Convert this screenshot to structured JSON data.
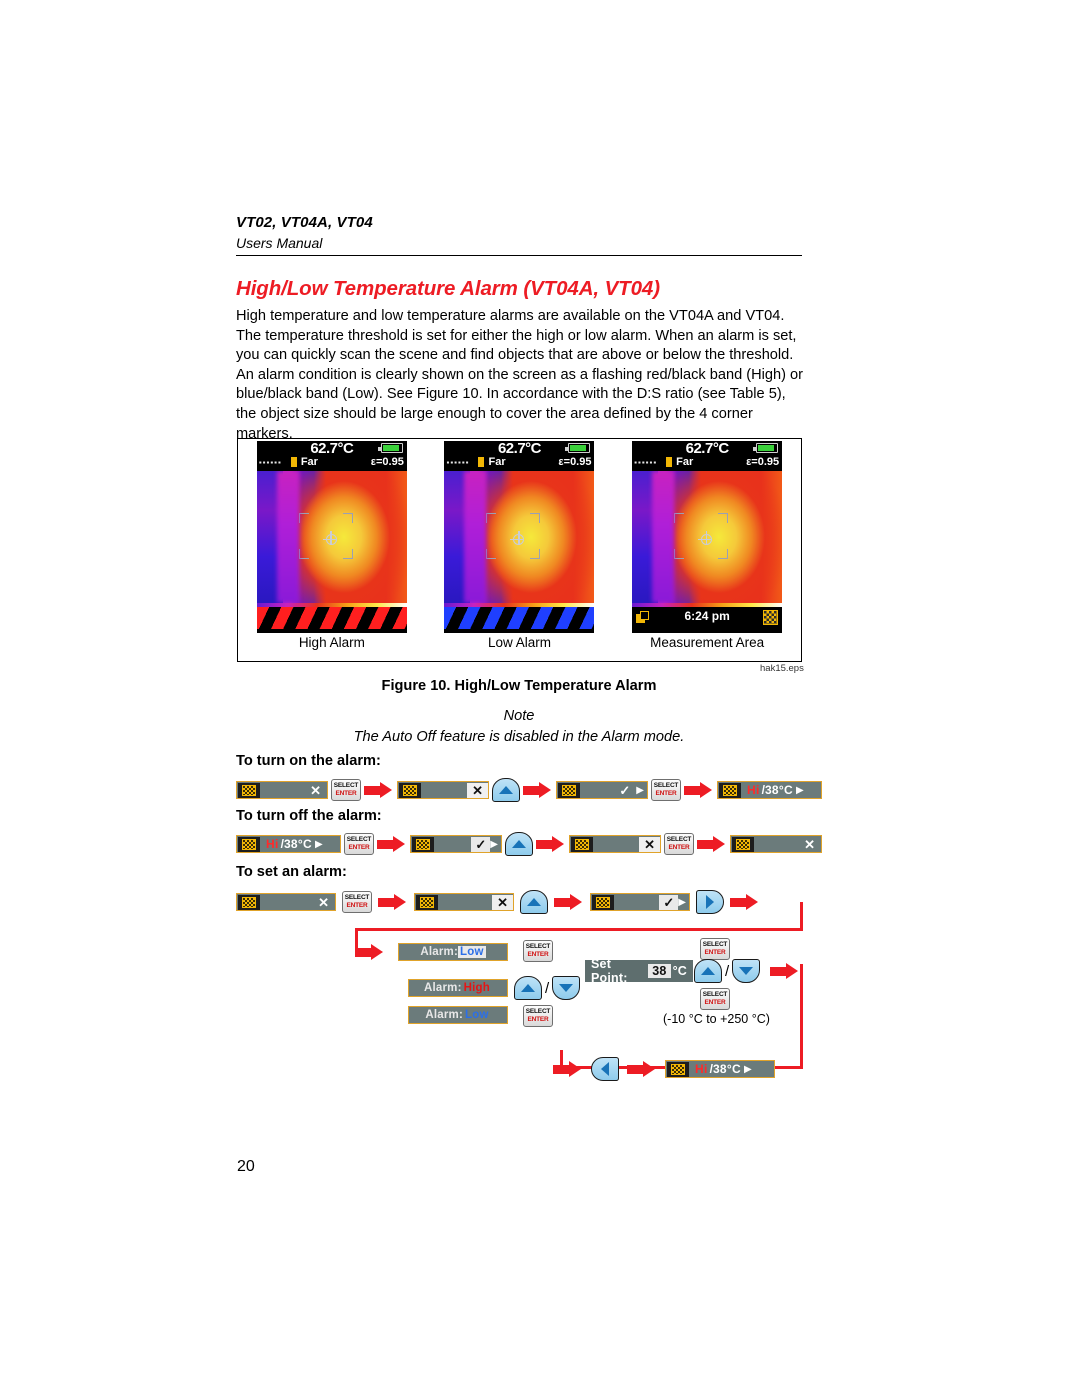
{
  "header": {
    "model_line": "VT02, VT04A, VT04",
    "manual_line": "Users Manual"
  },
  "section": {
    "title": "High/Low Temperature Alarm (VT04A, VT04)",
    "body": "High temperature and low temperature alarms are available on the VT04A and VT04. The temperature threshold is set for either the high or low alarm. When an alarm is set, you can quickly scan the scene and find objects that are above or below the threshold. An alarm condition is clearly shown on the screen as a flashing red/black band (High) or blue/black band (Low). See Figure 10. In accordance with the D:S ratio (see Table 5), the object size should be large enough to cover the area defined by the 4 corner markers."
  },
  "figure": {
    "caption": "Figure 10. High/Low Temperature Alarm",
    "eps_tag": "hak15.eps",
    "shots": [
      {
        "label": "High Alarm",
        "temperature": "62.7°C",
        "distance_mode": "Far",
        "emissivity": "ε=0.95",
        "band": "high",
        "band_text": "",
        "battery_icon": "battery-icon"
      },
      {
        "label": "Low Alarm",
        "temperature": "62.7°C",
        "distance_mode": "Far",
        "emissivity": "ε=0.95",
        "band": "low",
        "band_text": "",
        "battery_icon": "battery-icon"
      },
      {
        "label": "Measurement Area",
        "temperature": "62.7°C",
        "distance_mode": "Far",
        "emissivity": "ε=0.95",
        "band": "plain",
        "band_text": "6:24 pm",
        "battery_icon": "battery-icon"
      }
    ]
  },
  "note": {
    "word": "Note",
    "text": "The Auto Off feature is disabled in the Alarm mode."
  },
  "procedures": {
    "turn_on": {
      "heading": "To turn on the alarm:",
      "steps": [
        {
          "kind": "menubar",
          "icon": "grid-icon",
          "state": "x"
        },
        {
          "kind": "select",
          "line1": "SELECT",
          "line2": "ENTER"
        },
        {
          "kind": "arrow"
        },
        {
          "kind": "menubar",
          "icon": "grid-icon",
          "state": "x-boxed"
        },
        {
          "kind": "nav",
          "dir": "up"
        },
        {
          "kind": "arrow"
        },
        {
          "kind": "menubar",
          "icon": "grid-icon",
          "state": "check"
        },
        {
          "kind": "select",
          "line1": "SELECT",
          "line2": "ENTER"
        },
        {
          "kind": "arrow"
        },
        {
          "kind": "menubar",
          "icon": "grid-icon",
          "state": "value",
          "hi": "Hi",
          "sep": "/",
          "temp": "38°C"
        }
      ]
    },
    "turn_off": {
      "heading": "To turn off the alarm:",
      "steps": [
        {
          "kind": "menubar",
          "icon": "grid-icon",
          "state": "value",
          "hi": "Hi",
          "sep": "/",
          "temp": "38°C"
        },
        {
          "kind": "select",
          "line1": "SELECT",
          "line2": "ENTER"
        },
        {
          "kind": "arrow"
        },
        {
          "kind": "menubar",
          "icon": "grid-icon",
          "state": "check"
        },
        {
          "kind": "nav",
          "dir": "up"
        },
        {
          "kind": "arrow"
        },
        {
          "kind": "menubar",
          "icon": "grid-icon",
          "state": "x-boxed"
        },
        {
          "kind": "select",
          "line1": "SELECT",
          "line2": "ENTER"
        },
        {
          "kind": "arrow"
        },
        {
          "kind": "menubar",
          "icon": "grid-icon",
          "state": "x"
        }
      ]
    },
    "set_alarm": {
      "heading": "To set an alarm:",
      "row1": [
        {
          "kind": "menubar",
          "icon": "grid-icon",
          "state": "x"
        },
        {
          "kind": "select",
          "line1": "SELECT",
          "line2": "ENTER"
        },
        {
          "kind": "arrow"
        },
        {
          "kind": "menubar",
          "icon": "grid-icon",
          "state": "x-boxed"
        },
        {
          "kind": "nav",
          "dir": "up"
        },
        {
          "kind": "arrow"
        },
        {
          "kind": "menubar",
          "icon": "grid-icon",
          "state": "check"
        },
        {
          "kind": "nav",
          "dir": "right"
        },
        {
          "kind": "arrow"
        }
      ],
      "menu_items": [
        {
          "label": "Alarm:",
          "value": "Low",
          "style": "low-selected"
        },
        {
          "label": "Alarm:",
          "value": "High",
          "style": "high"
        },
        {
          "label": "Alarm:",
          "value": "Low",
          "style": "low"
        }
      ],
      "setpoint": {
        "label": "Set Point:",
        "value": "38",
        "unit": "°C",
        "range": "(-10 °C to +250 °C)"
      },
      "final_badge": {
        "hi": "Hi",
        "sep": "/",
        "temp": "38°C"
      },
      "select_button": {
        "line1": "SELECT",
        "line2": "ENTER"
      }
    }
  },
  "page_number": "20"
}
